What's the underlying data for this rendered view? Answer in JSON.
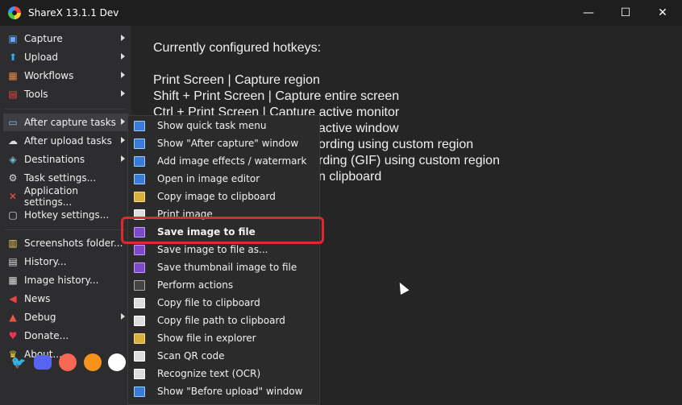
{
  "window": {
    "title": "ShareX 13.1.1 Dev",
    "minimize": "—",
    "maximize": "☐",
    "close": "✕"
  },
  "sidebar": {
    "items": [
      {
        "label": "Capture",
        "icon": "capture-icon",
        "submenu": true
      },
      {
        "label": "Upload",
        "icon": "upload-icon",
        "submenu": true
      },
      {
        "label": "Workflows",
        "icon": "workflows-icon",
        "submenu": true
      },
      {
        "label": "Tools",
        "icon": "tools-icon",
        "submenu": true
      },
      {
        "label": "After capture tasks",
        "icon": "after-capture-icon",
        "submenu": true
      },
      {
        "label": "After upload tasks",
        "icon": "after-upload-icon",
        "submenu": true
      },
      {
        "label": "Destinations",
        "icon": "destinations-icon",
        "submenu": true
      },
      {
        "label": "Task settings...",
        "icon": "task-settings-icon",
        "submenu": false
      },
      {
        "label": "Application settings...",
        "icon": "application-settings-icon",
        "submenu": false
      },
      {
        "label": "Hotkey settings...",
        "icon": "hotkey-settings-icon",
        "submenu": false
      },
      {
        "label": "Screenshots folder...",
        "icon": "folder-icon",
        "submenu": false
      },
      {
        "label": "History...",
        "icon": "history-icon",
        "submenu": false
      },
      {
        "label": "Image history...",
        "icon": "image-history-icon",
        "submenu": false
      },
      {
        "label": "News",
        "icon": "news-icon",
        "submenu": false
      },
      {
        "label": "Debug",
        "icon": "debug-icon",
        "submenu": true
      },
      {
        "label": "Donate...",
        "icon": "heart-icon",
        "submenu": false
      },
      {
        "label": "About...",
        "icon": "crown-icon",
        "submenu": false
      }
    ],
    "social": [
      "twitter-icon",
      "discord-icon",
      "patreon-icon",
      "bitcoin-icon",
      "github-icon"
    ]
  },
  "hotkeys": {
    "heading": "Currently configured hotkeys:",
    "lines": [
      "Print Screen  |  Capture region",
      "Shift + Print Screen  |  Capture entire screen",
      "Ctrl + Print Screen  |  Capture active monitor",
      "active window",
      "ording using custom region",
      "rding (GIF) using custom region",
      "n clipboard"
    ]
  },
  "submenu": {
    "items": [
      {
        "label": "Show quick task menu",
        "icon": "quick-task-icon"
      },
      {
        "label": "Show \"After capture\" window",
        "icon": "window-icon"
      },
      {
        "label": "Add image effects / watermark",
        "icon": "image-effects-icon"
      },
      {
        "label": "Open in image editor",
        "icon": "image-editor-icon"
      },
      {
        "label": "Copy image to clipboard",
        "icon": "clipboard-icon"
      },
      {
        "label": "Print image",
        "icon": "printer-icon"
      },
      {
        "label": "Save image to file",
        "icon": "save-icon"
      },
      {
        "label": "Save image to file as...",
        "icon": "save-as-icon"
      },
      {
        "label": "Save thumbnail image to file",
        "icon": "save-thumbnail-icon"
      },
      {
        "label": "Perform actions",
        "icon": "terminal-icon"
      },
      {
        "label": "Copy file to clipboard",
        "icon": "copy-file-icon"
      },
      {
        "label": "Copy file path to clipboard",
        "icon": "copy-path-icon"
      },
      {
        "label": "Show file in explorer",
        "icon": "explorer-icon"
      },
      {
        "label": "Scan QR code",
        "icon": "qr-code-icon"
      },
      {
        "label": "Recognize text (OCR)",
        "icon": "ocr-icon"
      },
      {
        "label": "Show \"Before upload\" window",
        "icon": "before-upload-icon"
      }
    ]
  },
  "colors": {
    "highlight": "#e0282f",
    "background": "#252526"
  }
}
